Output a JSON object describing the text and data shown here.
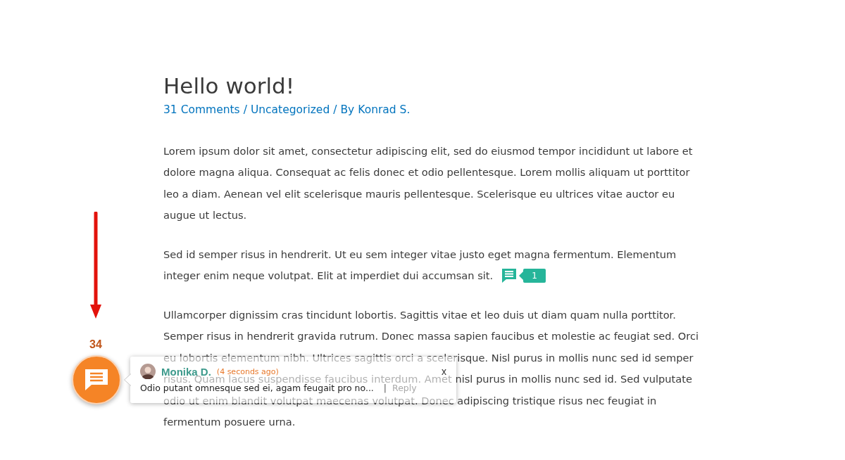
{
  "post": {
    "title": "Hello world!",
    "meta": {
      "comments": "31 Comments",
      "separator": "/",
      "category": "Uncategorized",
      "by": "By",
      "author": "Konrad S."
    },
    "paragraphs": [
      {
        "lines": [
          "Lorem ipsum dolor sit amet, consectetur adipiscing elit, sed do eiusmod tempor incididunt ut labore et",
          "dolore magna aliqua. Consequat ac felis donec et odio pellentesque. Lorem mollis aliquam ut porttitor",
          "leo a diam. Aenean vel elit scelerisque mauris pellentesque. Scelerisque eu ultrices vitae auctor eu",
          "augue ut lectus."
        ]
      },
      {
        "lines": [
          "Sed id semper risus in hendrerit. Ut eu sem integer vitae justo eget magna fermentum. Elementum",
          "integer enim neque volutpat. Elit at imperdiet dui accumsan sit."
        ],
        "comment_count": "1"
      },
      {
        "lines": [
          "Ullamcorper dignissim cras tincidunt lobortis. Sagittis vitae et leo duis ut diam quam nulla porttitor.",
          "Semper risus in hendrerit gravida rutrum. Donec massa sapien faucibus et molestie ac feugiat sed. Orci",
          "eu lobortis elementum nibh. Ultrices sagittis orci a scelerisque. Nisl purus in mollis nunc sed id semper",
          "risus. Quam lacus suspendisse faucibus interdum. Amet nisl purus in mollis nunc sed id. Sed vulputate",
          "odio ut enim blandit volutpat maecenas volutpat. Donec adipiscing tristique risus nec feugiat in",
          "fermentum posuere urna."
        ]
      }
    ]
  },
  "widget": {
    "count": "34"
  },
  "notification": {
    "name": "Monika D.",
    "time": "(4 seconds ago)",
    "close": "x",
    "excerpt": "Odio putant omnesque sed ei, agam feugait pro no...",
    "divider": "|",
    "reply": "Reply"
  }
}
